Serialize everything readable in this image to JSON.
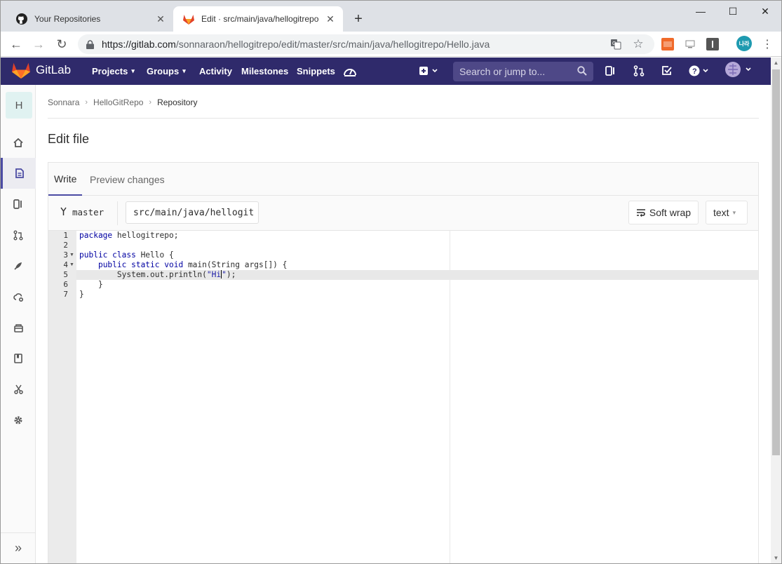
{
  "browser": {
    "tabs": [
      {
        "title": "Your Repositories",
        "favicon": "github-icon"
      },
      {
        "title": "Edit · src/main/java/hellogitrepo",
        "favicon": "gitlab-icon"
      }
    ],
    "url_host": "https://gitlab.com",
    "url_path": "/sonnaraon/hellogitrepo/edit/master/src/main/java/hellogitrepo/Hello.java",
    "extensions": [
      "ext-orange-icon",
      "ext-screen-icon",
      "ext-info-icon"
    ],
    "profile_initials": "나라"
  },
  "gitlab_header": {
    "brand": "GitLab",
    "nav": [
      "Projects",
      "Groups",
      "Activity",
      "Milestones",
      "Snippets"
    ],
    "search_placeholder": "Search or jump to..."
  },
  "sidebar": {
    "project_initial": "H",
    "items": [
      "project-home",
      "repository",
      "issues",
      "merge-requests",
      "ci-cd",
      "operations",
      "packages",
      "wiki",
      "snippets",
      "settings"
    ]
  },
  "breadcrumb": [
    "Sonnara",
    "HelloGitRepo",
    "Repository"
  ],
  "page_title": "Edit file",
  "editor": {
    "tabs": [
      "Write",
      "Preview changes"
    ],
    "branch": "master",
    "file_path": "src/main/java/hellogit",
    "soft_wrap": "Soft wrap",
    "language": "text",
    "line_numbers": [
      "1",
      "2",
      "3",
      "4",
      "5",
      "6",
      "7"
    ],
    "code": {
      "l1_kw": "package",
      "l1_rest": " hellogitrepo;",
      "l3_kw": "public class",
      "l3_rest": " Hello {",
      "l4_pre": "    ",
      "l4_kw": "public static void",
      "l4_rest": " main(String args[]) {",
      "l5_pre": "        System.out.println(",
      "l5_str_a": "\"Hi",
      "l5_str_b": "\"",
      "l5_end": ");",
      "l6": "    }",
      "l7": "}"
    }
  }
}
